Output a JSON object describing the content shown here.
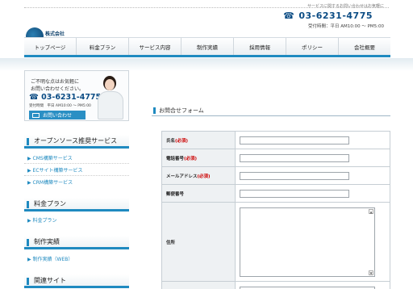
{
  "header": {
    "tagline": "サービスに関するお問い合わせはお気軽に",
    "phone": "03-6231-4775",
    "hours": "受付時間：平日 AM10:00 〜 PM5:00",
    "logo_text": "株式会社"
  },
  "nav": {
    "items": [
      "トップページ",
      "料金プラン",
      "サービス内容",
      "制作実績",
      "採用情報",
      "ポリシー",
      "会社概要"
    ]
  },
  "contact_box": {
    "line1": "ご不明な点はお気軽に",
    "line2": "お問い合わせください。",
    "phone": "03-6231-4775",
    "hours": "受付時間　平日 AM10:00 〜 PM5:00",
    "button": "お問い合わせ"
  },
  "sidebar": {
    "oss": {
      "title": "オープンソース推奨サービス",
      "links": [
        "CMS構築サービス",
        "ECサイト構築サービス",
        "CRM構築サービス"
      ]
    },
    "price": {
      "title": "料金プラン",
      "links": [
        "料金プラン"
      ]
    },
    "works": {
      "title": "制作実績",
      "links": [
        "制作実績（WEB）"
      ]
    },
    "related": {
      "title": "関連サイト"
    }
  },
  "form": {
    "title": "お問合せフォーム",
    "required_mark": "(必須)",
    "fields": {
      "name": "氏名",
      "tel": "電話番号",
      "email": "メールアドレス",
      "zip": "郵便番号",
      "address": "住所"
    }
  }
}
